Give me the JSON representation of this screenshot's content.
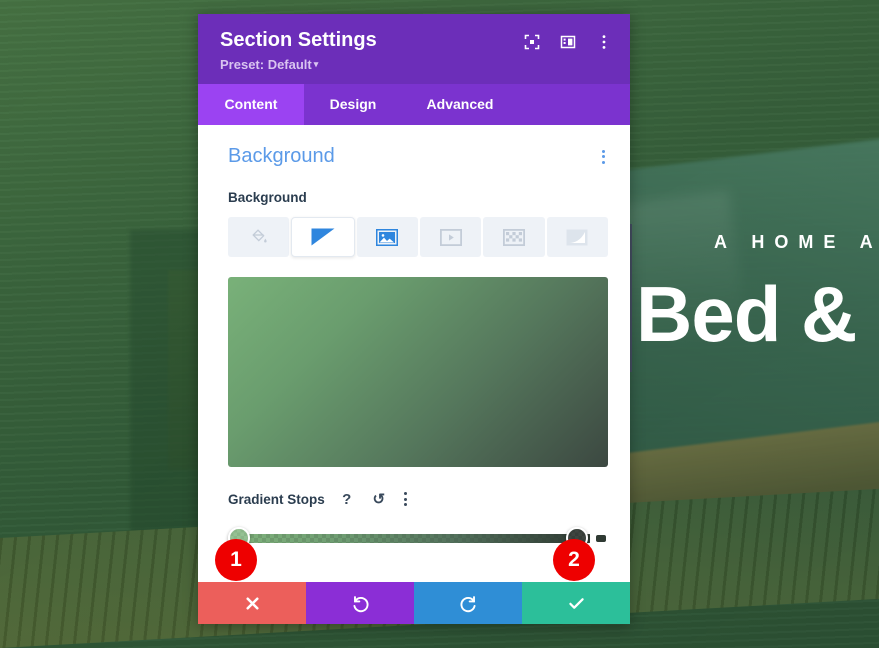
{
  "page_background": {
    "hero_eyebrow": "A HOME A",
    "hero_title": "Bed &",
    "scene": "green-tinted bedroom photo"
  },
  "modal": {
    "title": "Section Settings",
    "preset_label": "Preset: Default",
    "preset_caret": "▾",
    "header_icons": [
      {
        "name": "focus-target-icon",
        "title": "focus"
      },
      {
        "name": "panel-layout-icon",
        "title": "layout"
      },
      {
        "name": "kebab-menu-icon",
        "title": "more options"
      }
    ],
    "tabs": [
      {
        "label": "Content",
        "active": true
      },
      {
        "label": "Design",
        "active": false
      },
      {
        "label": "Advanced",
        "active": false
      }
    ],
    "section": {
      "title": "Background",
      "title_color": "#5b9ae8",
      "menu_icon": "kebab-menu-icon"
    },
    "background_field": {
      "label": "Background",
      "types": [
        {
          "name": "color-fill-icon",
          "label": "Background Color",
          "active": false
        },
        {
          "name": "gradient-icon",
          "label": "Background Gradient",
          "active": true
        },
        {
          "name": "image-icon",
          "label": "Background Image",
          "active": false
        },
        {
          "name": "video-icon",
          "label": "Background Video",
          "active": false
        },
        {
          "name": "pattern-icon",
          "label": "Background Pattern",
          "active": false
        },
        {
          "name": "mask-icon",
          "label": "Background Mask",
          "active": false
        }
      ]
    },
    "gradient_preview": {
      "start_color": "#79b179",
      "end_color": "#3c4841",
      "direction": "135deg"
    },
    "gradient_stops": {
      "label": "Gradient Stops",
      "help_glyph": "?",
      "reset_glyph": "↺",
      "menu_icon": "kebab-menu-icon",
      "stops": [
        {
          "position_percent": 0,
          "color": "#7ab178",
          "badge": "1"
        },
        {
          "position_percent": 93,
          "color": "#1e2621",
          "badge": "2"
        }
      ]
    },
    "footer_buttons": [
      {
        "name": "cancel-button",
        "glyph": "✖",
        "color": "#ec5f5b"
      },
      {
        "name": "undo-button",
        "glyph": "↺",
        "color": "#8b2ed6"
      },
      {
        "name": "redo-button",
        "glyph": "↻",
        "color": "#2f8ed6"
      },
      {
        "name": "save-button",
        "glyph": "✔",
        "color": "#2cbf9a"
      }
    ]
  },
  "callouts": [
    {
      "number": "1",
      "color": "#ee0000"
    },
    {
      "number": "2",
      "color": "#ee0000"
    }
  ]
}
